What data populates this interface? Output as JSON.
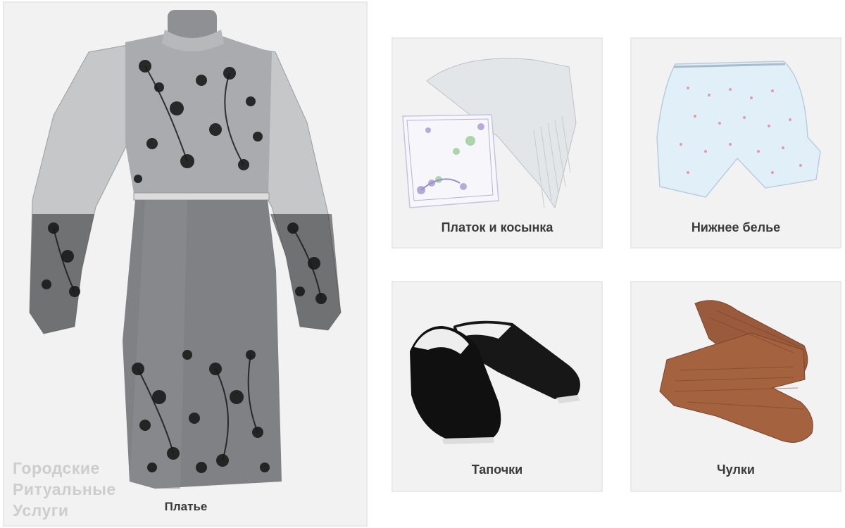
{
  "main_item": {
    "label": "Платье"
  },
  "watermark": {
    "lines": [
      "Городские",
      "Ритуальные",
      "Услуги"
    ]
  },
  "items": [
    {
      "label": "Платок и косынка"
    },
    {
      "label": "Нижнее белье"
    },
    {
      "label": "Тапочки"
    },
    {
      "label": "Чулки"
    }
  ],
  "colors": {
    "card_bg": "#f2f2f2",
    "card_border": "#e9e9e9",
    "label_text": "#3a3a3a",
    "dress_silver": "#b9bbbd",
    "floral_black": "#1a1a1a",
    "slipper_black": "#161616",
    "stocking_brown": "#9a5a3c",
    "underwear_blue": "#dfeef8"
  }
}
